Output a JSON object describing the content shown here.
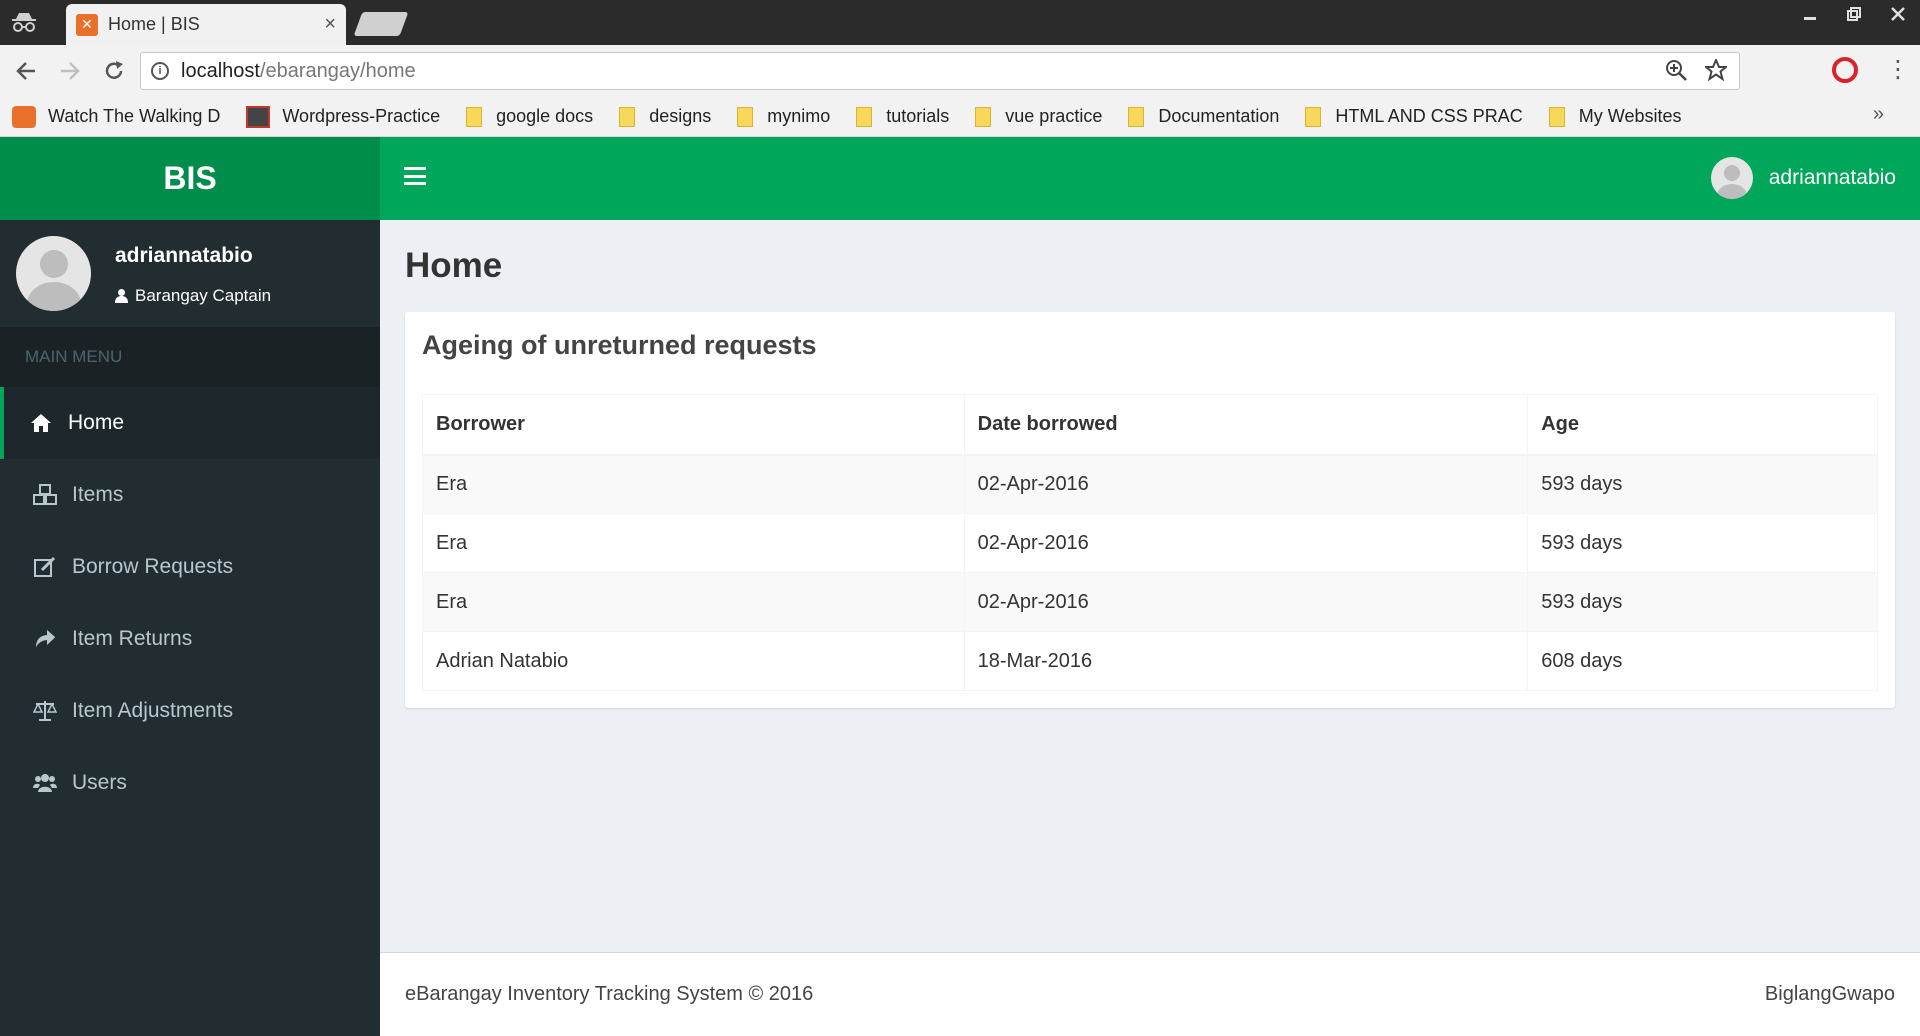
{
  "browser": {
    "tab_title": "Home | BIS",
    "tab_close": "×",
    "url_host": "localhost",
    "url_path": "/ebarangay/home",
    "bookmarks": [
      {
        "label": "Watch The Walking D",
        "icon": "orange-app-icon"
      },
      {
        "label": "Wordpress-Practice",
        "icon": "dark-app-icon"
      },
      {
        "label": "google docs",
        "icon": "folder-icon"
      },
      {
        "label": "designs",
        "icon": "folder-icon"
      },
      {
        "label": "mynimo",
        "icon": "folder-icon"
      },
      {
        "label": "tutorials",
        "icon": "folder-icon"
      },
      {
        "label": "vue practice",
        "icon": "folder-icon"
      },
      {
        "label": "Documentation",
        "icon": "folder-icon"
      },
      {
        "label": "HTML AND CSS PRAC",
        "icon": "folder-icon"
      },
      {
        "label": "My Websites",
        "icon": "folder-icon"
      }
    ],
    "bookmarks_overflow": "»"
  },
  "app": {
    "logo": "BIS",
    "top_user": "adriannatabio",
    "colors": {
      "primary": "#00a65a",
      "primary_dark": "#008d4c",
      "sidebar": "#222d32"
    }
  },
  "sidebar": {
    "user_name": "adriannatabio",
    "user_role": "Barangay Captain",
    "menu_header": "MAIN MENU",
    "items": [
      {
        "label": "Home",
        "icon": "home-icon",
        "active": true
      },
      {
        "label": "Items",
        "icon": "cubes-icon",
        "active": false
      },
      {
        "label": "Borrow Requests",
        "icon": "edit-icon",
        "active": false
      },
      {
        "label": "Item Returns",
        "icon": "share-arrow-icon",
        "active": false
      },
      {
        "label": "Item Adjustments",
        "icon": "balance-scale-icon",
        "active": false
      },
      {
        "label": "Users",
        "icon": "users-icon",
        "active": false
      }
    ]
  },
  "main": {
    "page_title": "Home",
    "box_title": "Ageing of unreturned requests",
    "table": {
      "headers": [
        "Borrower",
        "Date borrowed",
        "Age"
      ],
      "rows": [
        [
          "Era",
          "02-Apr-2016",
          "593 days"
        ],
        [
          "Era",
          "02-Apr-2016",
          "593 days"
        ],
        [
          "Era",
          "02-Apr-2016",
          "593 days"
        ],
        [
          "Adrian Natabio",
          "18-Mar-2016",
          "608 days"
        ]
      ]
    }
  },
  "footer": {
    "left": "eBarangay Inventory Tracking System © 2016",
    "right": "BiglangGwapo"
  }
}
